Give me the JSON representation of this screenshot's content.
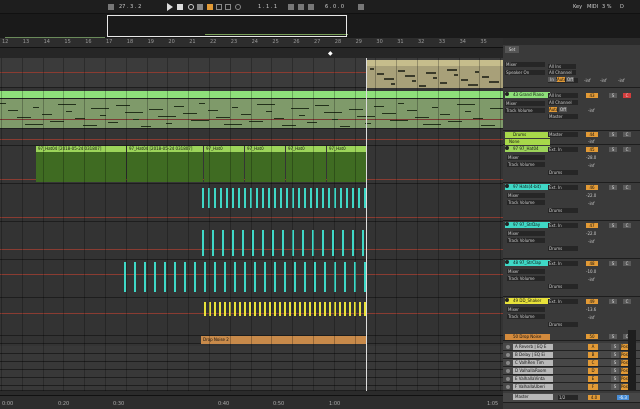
{
  "transport": {
    "position": "27 . 3 . 2",
    "loop_start": "1 . 1 . 1",
    "loop_length": "6 . 0 . 0",
    "key_label": "Key",
    "midi_label": "MIDI",
    "cpu": "3 %",
    "marker": "D",
    "set_label": "Set"
  },
  "ruler": {
    "bars": [
      "12",
      "13",
      "14",
      "15",
      "16",
      "17",
      "18",
      "19",
      "20",
      "21",
      "22",
      "23",
      "24",
      "25",
      "26",
      "27",
      "28",
      "29",
      "30",
      "31",
      "32",
      "33",
      "34",
      "35"
    ]
  },
  "time_ruler": {
    "times": [
      "0:00",
      "0:20",
      "0:30",
      "0:40",
      "0:50",
      "1:00",
      "1:05"
    ]
  },
  "colors": {
    "accent": "#e29a36",
    "green": "#8ee07a",
    "teal": "#3fd8c6",
    "yellow": "#e8e23a",
    "orange": "#d38a3c",
    "lime": "#a7d84a"
  },
  "clips": {
    "top": "",
    "synth": "",
    "h1": "97_Hat04 [2018-05-24 031807]",
    "h2": "97_Hat04 [2018-05-24 031807]",
    "h3": "97_Hat0",
    "h4": "97_Hat0",
    "h5": "97_Hat0",
    "h6": "97_Hat0",
    "drop": "Drop Noise 2"
  },
  "tracks": {
    "t0": {
      "input": "Mixer",
      "chain": "Speaker On",
      "val": "Master"
    },
    "t1": {
      "input": "All Ins",
      "channel": "All Channel",
      "in": "In",
      "auto": "Auto",
      "off": "Off",
      "inf1": "-inf",
      "inf2": "-inf",
      "inf3": "-inf"
    },
    "t2": {
      "name": "43 Grand Piano",
      "input": "All Ins",
      "channel": "All Channel",
      "num": "43",
      "s": "S",
      "c": "C",
      "mixer": "Mixer",
      "chain": "Track Volume",
      "out": "Master",
      "auto": "Auto",
      "off": "Off",
      "inf": "-inf"
    },
    "t3": {
      "name": "Drums",
      "out": "Master",
      "num": "44",
      "s": "S",
      "c": "C",
      "sub": "None",
      "inf": "-inf"
    },
    "t4": {
      "name": "97 97_Hat04",
      "input": "Ext. In",
      "num": "45",
      "vol": "-28.0",
      "mixer": "Mixer",
      "chain": "Track Volume",
      "out": "Drums",
      "s": "S",
      "c": "C",
      "inf": "-inf"
    },
    "t5": {
      "name": "97 Hats(4-bit)",
      "input": "Ext. In",
      "num": "46",
      "vol": "-22.0",
      "mixer": "Mixer",
      "chain": "Track Volume",
      "out": "Drums",
      "s": "S",
      "c": "C",
      "inf": "-inf"
    },
    "t6": {
      "name": "97 97_StrDay",
      "input": "Ext. In",
      "num": "47",
      "vol": "-22.0",
      "mixer": "Mixer",
      "chain": "Track Volume",
      "out": "Drums",
      "s": "S",
      "c": "C",
      "inf": "-inf"
    },
    "t7": {
      "name": "48 97_StrClap",
      "input": "Ext. In",
      "num": "48",
      "vol": "-10.0",
      "mixer": "Mixer",
      "chain": "Track Volume",
      "out": "Drums",
      "s": "S",
      "c": "C",
      "inf": "-inf"
    },
    "t8": {
      "name": "49 DD_Shaker",
      "input": "Ext. In",
      "num": "49",
      "vol": "-13.6",
      "mixer": "Mixer",
      "chain": "Track Volume",
      "out": "Drums",
      "s": "S",
      "c": "C",
      "inf": "-inf"
    },
    "t9": {
      "name": "50 Drop Noise",
      "num": "50",
      "s": "S",
      "c": "C"
    }
  },
  "returns": [
    {
      "label": "A Reverb | EQ E",
      "num": "A",
      "s": "S",
      "r": "Post"
    },
    {
      "label": "B Delay | EQ Ei",
      "num": "B",
      "s": "S",
      "r": "Post"
    },
    {
      "label": "C ValhRen Tim",
      "num": "C",
      "s": "S",
      "r": "Post"
    },
    {
      "label": "D ValhallaRoom",
      "num": "D",
      "s": "S",
      "r": "Post"
    },
    {
      "label": "E ValhallaVinta",
      "num": "E",
      "s": "S",
      "r": "Post"
    },
    {
      "label": "F ValhallaUberi",
      "num": "F",
      "s": "S",
      "r": "Post"
    }
  ],
  "master": {
    "label": "Master",
    "ratio": "1/2",
    "val": "4.0",
    "vol": "-6.3"
  }
}
